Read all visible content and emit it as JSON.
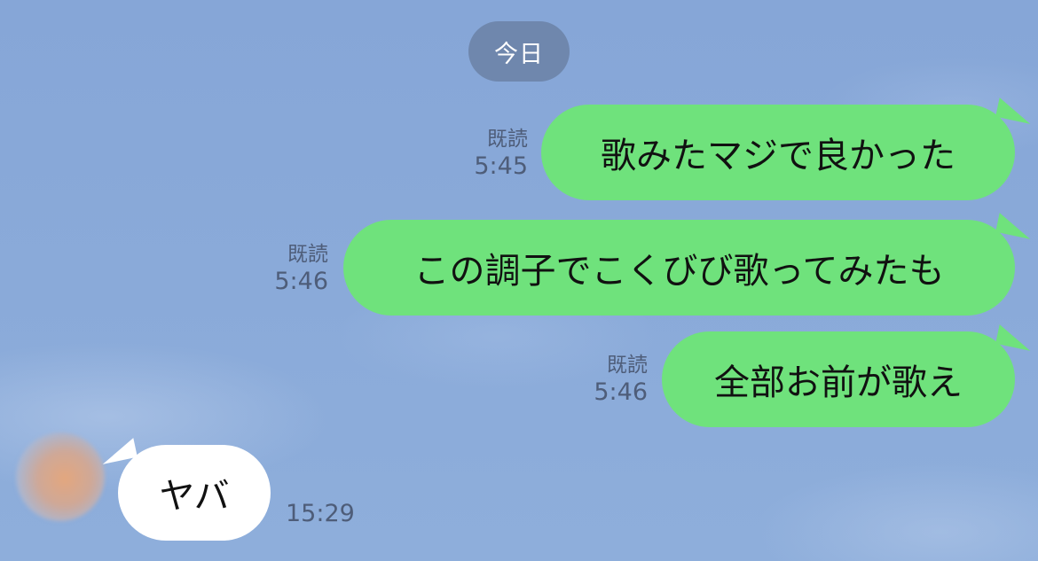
{
  "date_label": "今日",
  "messages": [
    {
      "direction": "out",
      "text": "歌みたマジで良かった",
      "read": "既読",
      "time": "5:45"
    },
    {
      "direction": "out",
      "text": "この調子でこくびび歌ってみたも",
      "read": "既読",
      "time": "5:46"
    },
    {
      "direction": "out",
      "text": "全部お前が歌え",
      "read": "既読",
      "time": "5:46"
    },
    {
      "direction": "in",
      "text": "ヤバ",
      "time": "15:29"
    }
  ],
  "colors": {
    "background": "#8aaad8",
    "outgoing_bubble": "#6fe27c",
    "incoming_bubble": "#ffffff",
    "date_pill": "#6f87ad",
    "meta_text": "#4e5d79"
  },
  "icons": [
    "contact-avatar"
  ]
}
